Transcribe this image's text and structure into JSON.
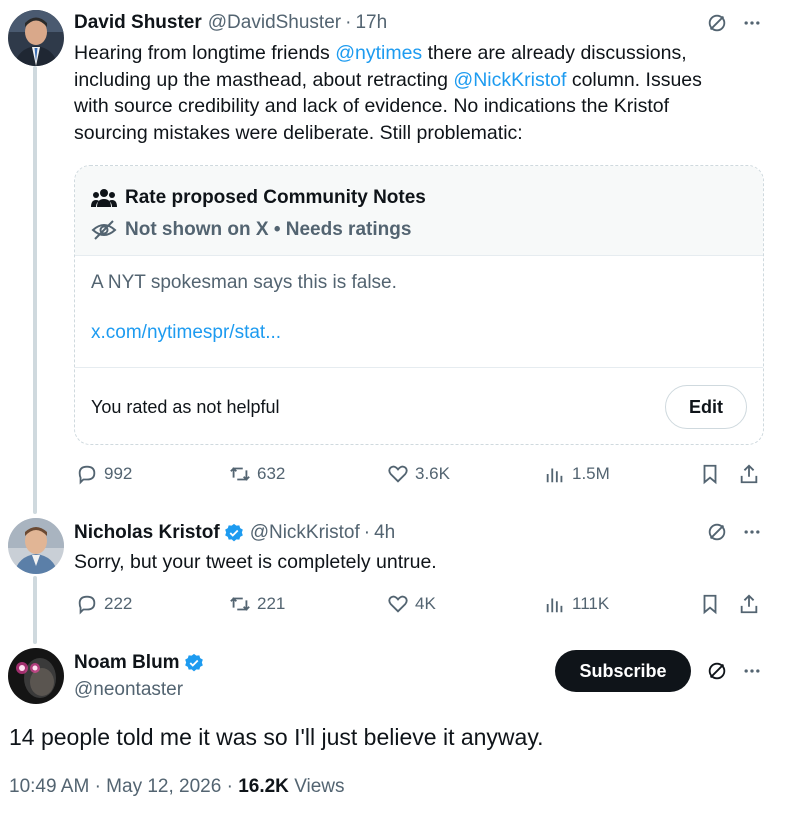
{
  "tweet1": {
    "name": "David Shuster",
    "handle": "@DavidShuster",
    "sep": "·",
    "time": "17h",
    "line1_pre": "Hearing from longtime friends ",
    "line1_mention": "@nytimes",
    "line1_post": " there are already discussions,",
    "line2_pre": "including up the masthead, about retracting ",
    "line2_mention": "@NickKristof",
    "line2_post": " column.  Issues",
    "line3": "with source credibility and lack of evidence. No indications the Kristof",
    "line4": "sourcing mistakes were deliberate.  Still problematic:",
    "note": {
      "title": "Rate proposed Community Notes",
      "status": "Not shown on X • Needs ratings",
      "text": "A NYT spokesman says this is false.",
      "link": "x.com/nytimespr/stat...",
      "rated": "You rated as not helpful",
      "edit": "Edit"
    },
    "stats": {
      "replies": "992",
      "reposts": "632",
      "likes": "3.6K",
      "views": "1.5M"
    }
  },
  "tweet2": {
    "name": "Nicholas Kristof",
    "handle": "@NickKristof",
    "sep": "·",
    "time": "4h",
    "text": "Sorry, but your tweet is completely untrue.",
    "stats": {
      "replies": "222",
      "reposts": "221",
      "likes": "4K",
      "views": "111K"
    }
  },
  "tweet3": {
    "name": "Noam Blum",
    "handle": "@neontaster",
    "subscribe": "Subscribe",
    "text": "14 people told me it was so I'll just believe it anyway.",
    "time": "10:49 AM",
    "dot1": "·",
    "date": "May 12, 2026",
    "dot2": "·",
    "views_count": "16.2K",
    "views_label": "Views"
  },
  "colors": {
    "accent": "#1d9bf0",
    "muted": "#536471",
    "text": "#0f1419"
  }
}
